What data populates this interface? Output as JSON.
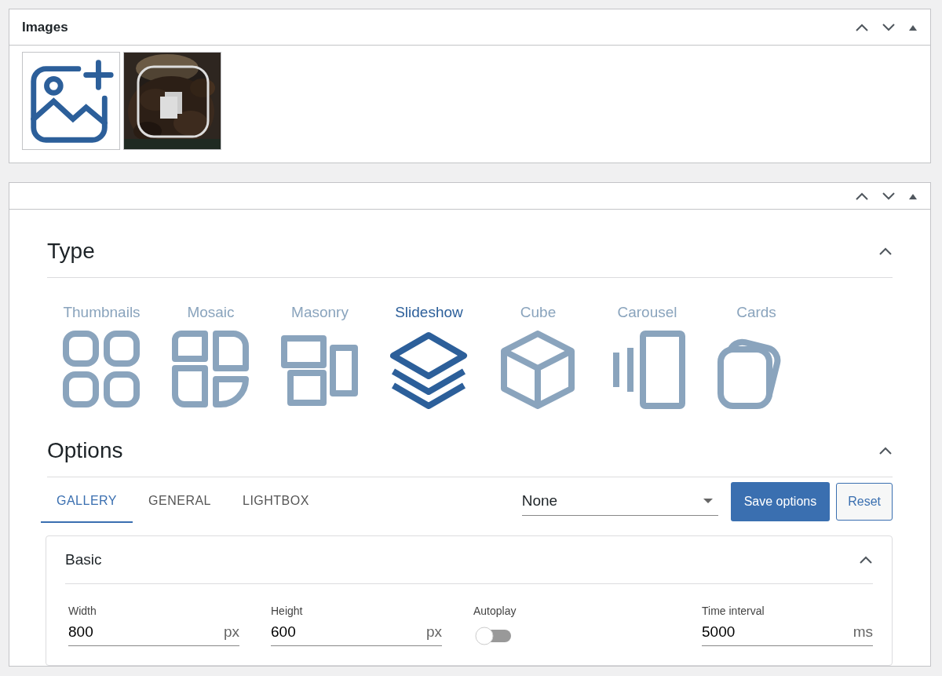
{
  "images_panel": {
    "title": "Images",
    "items": [
      {
        "kind": "add"
      },
      {
        "kind": "picture"
      }
    ]
  },
  "settings_panel": {
    "type_section": {
      "title": "Type",
      "expanded": true,
      "types": [
        {
          "label": "Thumbnails",
          "kind": "thumbnails",
          "selected": false
        },
        {
          "label": "Mosaic",
          "kind": "mosaic",
          "selected": false
        },
        {
          "label": "Masonry",
          "kind": "masonry",
          "selected": false
        },
        {
          "label": "Slideshow",
          "kind": "slideshow",
          "selected": true
        },
        {
          "label": "Cube",
          "kind": "cube",
          "selected": false
        },
        {
          "label": "Carousel",
          "kind": "carousel",
          "selected": false
        },
        {
          "label": "Cards",
          "kind": "cards",
          "selected": false
        }
      ]
    },
    "options_section": {
      "title": "Options",
      "expanded": true,
      "tabs": [
        {
          "label": "GALLERY",
          "selected": true
        },
        {
          "label": "GENERAL",
          "selected": false
        },
        {
          "label": "LIGHTBOX",
          "selected": false
        }
      ],
      "preset": {
        "value": "None"
      },
      "buttons": [
        {
          "label": "Save options",
          "kind": "primary"
        },
        {
          "label": "Reset",
          "kind": "secondary"
        }
      ],
      "basic": {
        "title": "Basic",
        "expanded": true,
        "fields": [
          {
            "kind": "number",
            "label": "Width",
            "value": "800",
            "unit": "px"
          },
          {
            "kind": "number",
            "label": "Height",
            "value": "600",
            "unit": "px"
          },
          {
            "kind": "toggle",
            "label": "Autoplay",
            "on": false
          },
          {
            "kind": "number",
            "label": "Time interval",
            "value": "5000",
            "unit": "ms"
          }
        ]
      }
    }
  }
}
